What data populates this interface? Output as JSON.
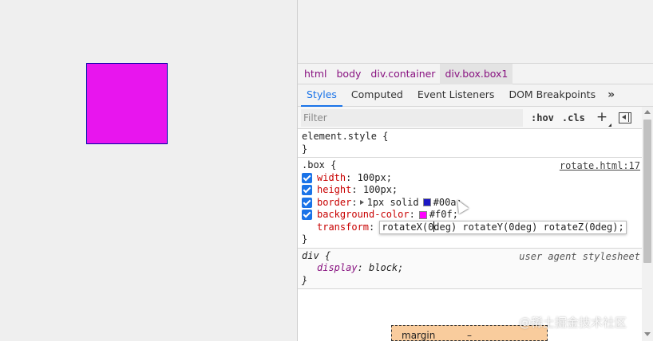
{
  "page": {
    "box_color": "#f0f",
    "box_border_color": "#00a"
  },
  "breadcrumbs": [
    "html",
    "body",
    "div.container",
    "div.box.box1"
  ],
  "tabs": [
    "Styles",
    "Computed",
    "Event Listeners",
    "DOM Breakpoints",
    "»"
  ],
  "filter": {
    "placeholder": "Filter",
    "hov": ":hov",
    "cls": ".cls",
    "plus": "+"
  },
  "rules": {
    "element_style": {
      "selector": "element.style {",
      "close": "}"
    },
    "box": {
      "selector": ".box",
      "open": "{",
      "source": "rotate.html:17",
      "width": {
        "name": "width",
        "value": "100px;"
      },
      "height": {
        "name": "height",
        "value": "100px;"
      },
      "border": {
        "name": "border",
        "value_prefix": "1px solid",
        "swatch_color": "#00a",
        "value": "#00a;"
      },
      "background": {
        "name": "background-color",
        "swatch_color": "#f0f",
        "value": "#f0f;"
      },
      "transform": {
        "name": "transform",
        "value_before_caret": "rotateX(0",
        "value_after_caret": "deg) rotateY(0deg)  rotateZ(0deg);"
      },
      "close": "}"
    },
    "div": {
      "selector": "div",
      "open": "{",
      "source": "user agent stylesheet",
      "display": {
        "name": "display",
        "value": "block;"
      },
      "close": "}"
    }
  },
  "boxmodel": {
    "label": "margin",
    "value": "–"
  },
  "watermark": "@稀土掘金技术社区"
}
